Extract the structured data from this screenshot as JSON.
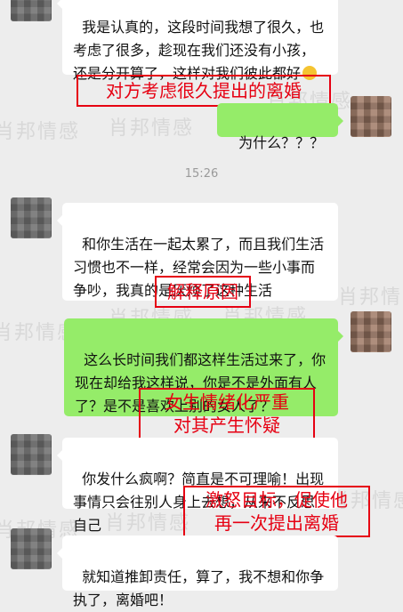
{
  "watermark_text": "肖邦情感",
  "timestamp": "15:26",
  "colors": {
    "background": "#ededed",
    "incoming_bubble": "#ffffff",
    "outgoing_bubble": "#95ec69",
    "annotation": "#e60012"
  },
  "messages": [
    {
      "side": "incoming",
      "text": "我是认真的，这段时间我想了很久，也考虑了很多，趁现在我们还没有小孩，还是分开算了，这样对我们彼此都好",
      "emoji": "smile-emoji"
    },
    {
      "side": "outgoing",
      "text": "为什么？？？"
    },
    {
      "side": "incoming",
      "text": "和你生活在一起太累了，而且我们生活习惯也不一样，经常会因为一些小事而争吵，我真的是厌烦了这种生活"
    },
    {
      "side": "outgoing",
      "text": "这么长时间我们都这样生活过来了，你现在却给我这样说，你是不是外面有人了？是不是喜欢上别的女人了？"
    },
    {
      "side": "incoming",
      "text": "你发什么疯啊？简直是不可理喻！出现事情只会往别人身上去想，从来不反思自己"
    },
    {
      "side": "incoming",
      "text": "就知道推卸责任，算了，我不想和你争执了，离婚吧！"
    }
  ],
  "annotations": [
    {
      "text": "对方考虑很久提出的离婚"
    },
    {
      "text": "解释原因"
    },
    {
      "text": "女生情绪化严重\n对其产生怀疑"
    },
    {
      "text": "激怒目标，促使他\n再一次提出离婚"
    }
  ]
}
